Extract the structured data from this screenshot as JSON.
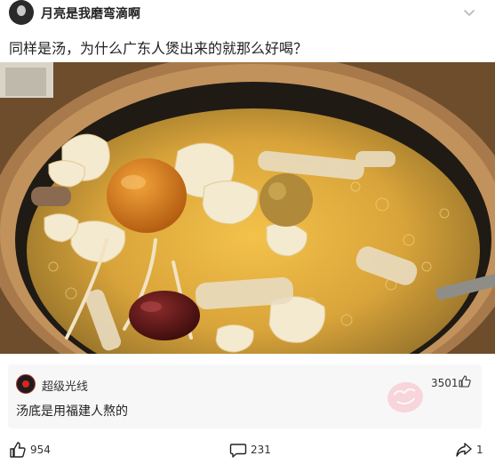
{
  "post": {
    "author": "月亮是我磨弯滴啊",
    "title": "同样是汤，为什么广东人煲出来的就那么好喝？"
  },
  "comment": {
    "username": "超级光线",
    "text": "汤底是用福建人熬的",
    "likes": "3501"
  },
  "actions": {
    "likes": "954",
    "comments": "231",
    "shares": "1"
  },
  "icons": {
    "menu": "chevron-down-icon",
    "like": "thumbs-up-icon",
    "comment": "speech-bubble-icon",
    "share": "share-arrow-icon"
  },
  "colors": {
    "text": "#222222",
    "card_background": "#f7f7f7",
    "watermark": "#f596a5"
  }
}
